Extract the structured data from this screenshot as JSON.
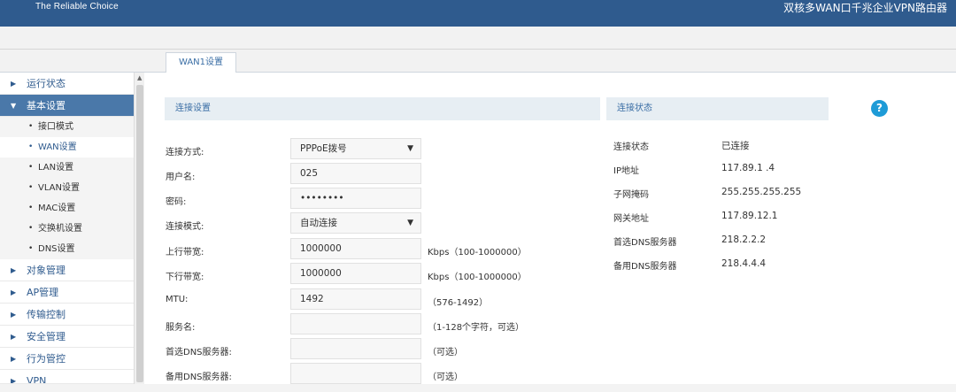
{
  "header": {
    "brand": "The Reliable Choice",
    "product": "双核多WAN口千兆企业VPN路由器"
  },
  "tabs": [
    {
      "label": "WAN1设置"
    }
  ],
  "sidebar": {
    "items": [
      {
        "label": "运行状态"
      },
      {
        "label": "基本设置"
      },
      {
        "label": "对象管理"
      },
      {
        "label": "AP管理"
      },
      {
        "label": "传输控制"
      },
      {
        "label": "安全管理"
      },
      {
        "label": "行为管控"
      },
      {
        "label": "VPN"
      }
    ],
    "subitems": [
      {
        "label": "接口模式"
      },
      {
        "label": "WAN设置"
      },
      {
        "label": "LAN设置"
      },
      {
        "label": "VLAN设置"
      },
      {
        "label": "MAC设置"
      },
      {
        "label": "交换机设置"
      },
      {
        "label": "DNS设置"
      }
    ]
  },
  "connection_settings": {
    "title": "连接设置",
    "fields": [
      {
        "label": "连接方式:",
        "value": "PPPoE拨号",
        "hint": ""
      },
      {
        "label": "用户名:",
        "value": "025",
        "hint": ""
      },
      {
        "label": "密码:",
        "value": "••••••••",
        "hint": ""
      },
      {
        "label": "连接模式:",
        "value": "自动连接",
        "hint": ""
      },
      {
        "label": "上行带宽:",
        "value": "1000000",
        "hint": "Kbps（100-1000000）"
      },
      {
        "label": "下行带宽:",
        "value": "1000000",
        "hint": "Kbps（100-1000000）"
      },
      {
        "label": "MTU:",
        "value": "1492",
        "hint": "（576-1492）"
      },
      {
        "label": "服务名:",
        "value": "",
        "hint": "（1-128个字符，可选）"
      },
      {
        "label": "首选DNS服务器:",
        "value": "",
        "hint": "（可选）"
      },
      {
        "label": "备用DNS服务器:",
        "value": "",
        "hint": "（可选）"
      }
    ]
  },
  "connection_status": {
    "title": "连接状态",
    "rows": [
      {
        "label": "连接状态",
        "value": "已连接"
      },
      {
        "label": "IP地址",
        "value": "117.89.1  .4"
      },
      {
        "label": "子网掩码",
        "value": "255.255.255.255"
      },
      {
        "label": "网关地址",
        "value": "117.89.12.1"
      },
      {
        "label": "首选DNS服务器",
        "value": "218.2.2.2"
      },
      {
        "label": "备用DNS服务器",
        "value": "218.4.4.4"
      }
    ]
  },
  "help": {
    "symbol": "?"
  }
}
